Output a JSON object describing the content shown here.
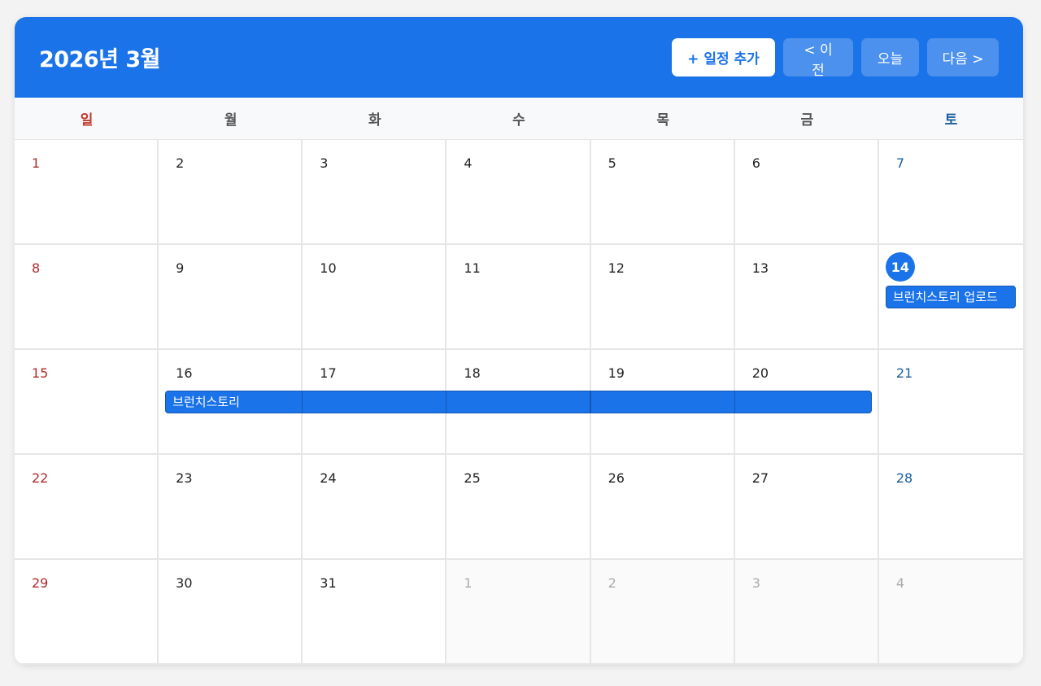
{
  "header": {
    "title": "2026년 3월",
    "add_label": "+ 일정 추가",
    "prev_label": "< 이전",
    "today_label": "오늘",
    "next_label": "다음 >"
  },
  "weekdays": [
    "일",
    "월",
    "화",
    "수",
    "목",
    "금",
    "토"
  ],
  "weeks": [
    [
      "1",
      "2",
      "3",
      "4",
      "5",
      "6",
      "7"
    ],
    [
      "8",
      "9",
      "10",
      "11",
      "12",
      "13",
      "14"
    ],
    [
      "15",
      "16",
      "17",
      "18",
      "19",
      "20",
      "21"
    ],
    [
      "22",
      "23",
      "24",
      "25",
      "26",
      "27",
      "28"
    ],
    [
      "29",
      "30",
      "31",
      "1",
      "2",
      "3",
      "4"
    ]
  ],
  "today": "14",
  "events": {
    "upload_title": "브런치스토리 업로드",
    "series_title": "브런치스토리"
  },
  "colors": {
    "accent": "#1a73e8",
    "sunday": "#b02a2a",
    "saturday": "#1a5fa0"
  }
}
